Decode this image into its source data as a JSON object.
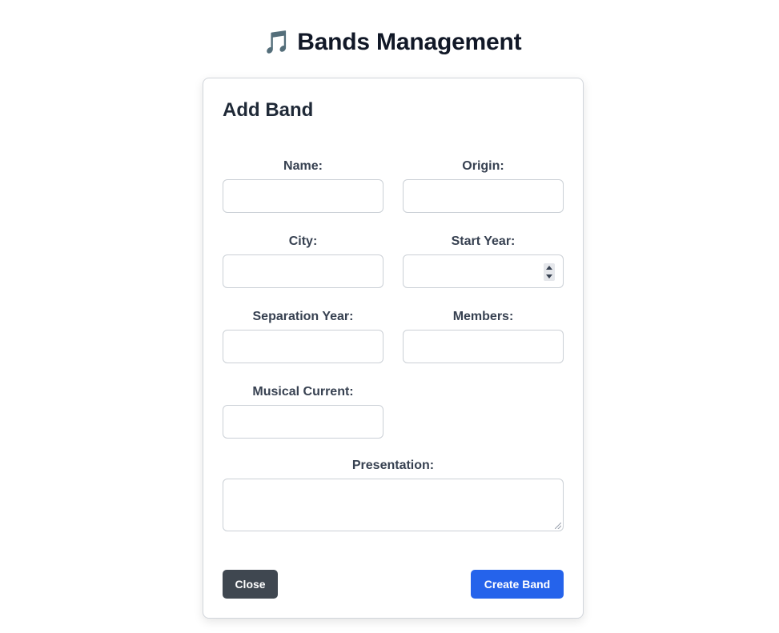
{
  "header": {
    "icon": "musical-note-icon",
    "icon_glyph": "🎵",
    "title": "Bands Management"
  },
  "modal": {
    "title": "Add Band",
    "fields": {
      "name": {
        "label": "Name:",
        "value": ""
      },
      "origin": {
        "label": "Origin:",
        "value": ""
      },
      "city": {
        "label": "City:",
        "value": ""
      },
      "start_year": {
        "label": "Start Year:",
        "value": ""
      },
      "separation_year": {
        "label": "Separation Year:",
        "value": ""
      },
      "members": {
        "label": "Members:",
        "value": ""
      },
      "musical_current": {
        "label": "Musical Current:",
        "value": ""
      },
      "presentation": {
        "label": "Presentation:",
        "value": ""
      }
    },
    "buttons": {
      "close": "Close",
      "create": "Create Band"
    }
  },
  "colors": {
    "primary": "#2563eb",
    "secondary": "#3f4750",
    "border": "#cbd0d6"
  }
}
